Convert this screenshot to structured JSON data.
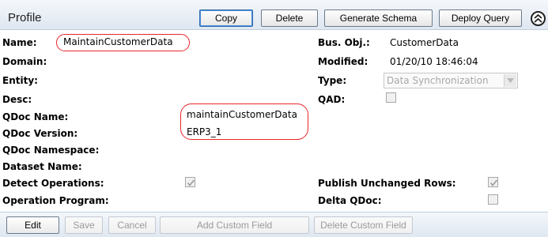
{
  "header": {
    "title": "Profile",
    "buttons": {
      "copy": "Copy",
      "delete": "Delete",
      "generate_schema": "Generate Schema",
      "deploy_query": "Deploy Query"
    },
    "collapse_icon": "collapse-up-icon"
  },
  "fields_left": {
    "name_label": "Name:",
    "name_value": "MaintainCustomerData",
    "domain_label": "Domain:",
    "entity_label": "Entity:",
    "desc_label": "Desc:",
    "qdoc_name_label": "QDoc Name:",
    "qdoc_name_value": "maintainCustomerData",
    "qdoc_version_label": "QDoc Version:",
    "qdoc_version_value": "ERP3_1",
    "qdoc_namespace_label": "QDoc Namespace:",
    "dataset_name_label": "Dataset Name:",
    "detect_operations_label": "Detect Operations:",
    "detect_operations_checked": true,
    "operation_program_label": "Operation Program:"
  },
  "fields_right": {
    "bus_obj_label": "Bus. Obj.:",
    "bus_obj_value": "CustomerData",
    "modified_label": "Modified:",
    "modified_value": "01/20/10 18:46:04",
    "type_label": "Type:",
    "type_value": "Data Synchronization",
    "qad_label": "QAD:",
    "qad_checked": false,
    "publish_unchanged_label": "Publish Unchanged Rows:",
    "publish_unchanged_checked": true,
    "delta_qdoc_label": "Delta QDoc:",
    "delta_qdoc_checked": false
  },
  "footer": {
    "edit": "Edit",
    "save": "Save",
    "cancel": "Cancel",
    "add_custom_field": "Add Custom Field",
    "delete_custom_field": "Delete Custom Field"
  },
  "colors": {
    "highlight_oval": "#e8262b",
    "bar_gradient_top": "#f4f7fb",
    "bar_gradient_bottom": "#dfe7f1",
    "disabled_text": "#9a9a9a"
  }
}
